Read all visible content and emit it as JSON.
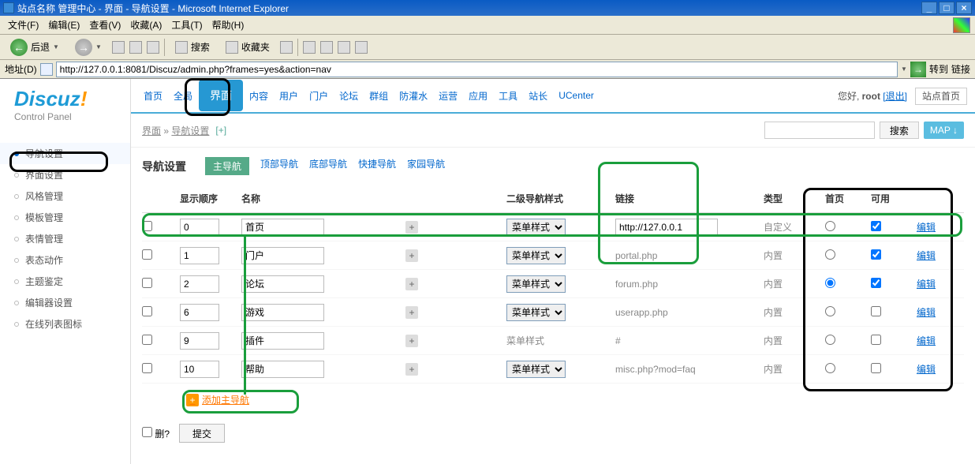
{
  "window": {
    "title": "站点名称 管理中心 - 界面 - 导航设置 - Microsoft Internet Explorer"
  },
  "menu": {
    "file": "文件(F)",
    "edit": "编辑(E)",
    "view": "查看(V)",
    "fav": "收藏(A)",
    "tools": "工具(T)",
    "help": "帮助(H)"
  },
  "toolbar": {
    "back": "后退",
    "search": "搜索",
    "fav": "收藏夹"
  },
  "addr": {
    "label": "地址(D)",
    "value": "http://127.0.0.1:8081/Discuz/admin.php?frames=yes&action=nav",
    "go": "转到",
    "links": "链接"
  },
  "logo": {
    "brand": "Discuz",
    "ex": "!",
    "sub": "Control Panel"
  },
  "side": {
    "items": [
      "导航设置",
      "界面设置",
      "风格管理",
      "模板管理",
      "表情管理",
      "表态动作",
      "主题鉴定",
      "编辑器设置",
      "在线列表图标"
    ]
  },
  "topnav": {
    "items": [
      "首页",
      "全局",
      "界面",
      "内容",
      "用户",
      "门户",
      "论坛",
      "群组",
      "防灌水",
      "运营",
      "应用",
      "工具",
      "站长",
      "UCenter"
    ],
    "hello": "您好,",
    "user": "root",
    "logout": "[退出]",
    "sitehome": "站点首页"
  },
  "crumb": {
    "a": "界面",
    "sep": "»",
    "b": "导航设置",
    "plus": "[+]"
  },
  "search": {
    "placeholder": "",
    "btn": "搜索",
    "map": "MAP ↓"
  },
  "tabs": {
    "title": "导航设置",
    "items": [
      "主导航",
      "顶部导航",
      "底部导航",
      "快捷导航",
      "家园导航"
    ]
  },
  "thead": {
    "order": "显示顺序",
    "name": "名称",
    "sub": "二级导航样式",
    "link": "链接",
    "type": "类型",
    "home": "首页",
    "enable": "可用"
  },
  "rows": [
    {
      "order": "0",
      "name": "首页",
      "sub": "菜单样式",
      "link": "http://127.0.0.1",
      "linkempty": false,
      "type": "自定义",
      "home": false,
      "enable": true,
      "hasSel": true
    },
    {
      "order": "1",
      "name": "门户",
      "sub": "菜单样式",
      "link": "portal.php",
      "linkempty": true,
      "type": "内置",
      "home": false,
      "enable": true,
      "hasSel": true
    },
    {
      "order": "2",
      "name": "论坛",
      "sub": "菜单样式",
      "link": "forum.php",
      "linkempty": true,
      "type": "内置",
      "home": true,
      "enable": true,
      "hasSel": true
    },
    {
      "order": "6",
      "name": "游戏",
      "sub": "菜单样式",
      "link": "userapp.php",
      "linkempty": true,
      "type": "内置",
      "home": false,
      "enable": false,
      "hasSel": true
    },
    {
      "order": "9",
      "name": "插件",
      "sub": "菜单样式",
      "link": "#",
      "linkempty": true,
      "type": "内置",
      "home": false,
      "enable": false,
      "hasSel": false
    },
    {
      "order": "10",
      "name": "帮助",
      "sub": "菜单样式",
      "link": "misc.php?mod=faq",
      "linkempty": true,
      "type": "内置",
      "home": false,
      "enable": false,
      "hasSel": true
    }
  ],
  "add": {
    "label": "添加主导航"
  },
  "submit": {
    "del": "删?",
    "btn": "提交"
  },
  "edit": "编辑"
}
